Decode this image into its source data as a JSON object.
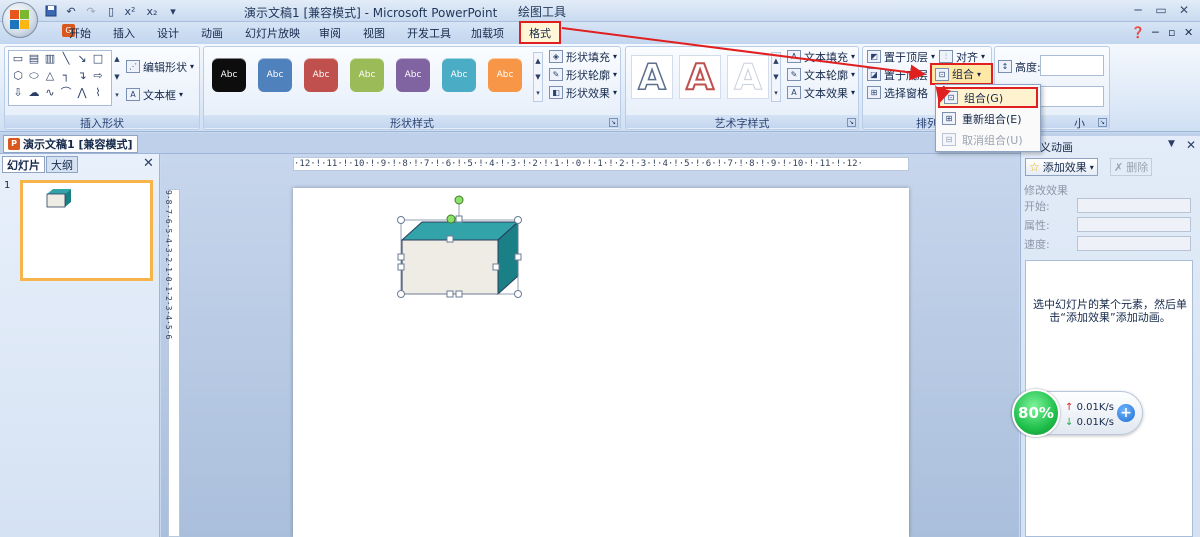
{
  "window": {
    "title": "演示文稿1 [兼容模式] - Microsoft PowerPoint",
    "context_tool_title": "绘图工具"
  },
  "tabs": {
    "home": "开始",
    "insert": "插入",
    "design": "设计",
    "animation": "动画",
    "slideshow": "幻灯片放映",
    "review": "审阅",
    "view": "视图",
    "developer": "开发工具",
    "addins": "加载项",
    "format": "格式"
  },
  "ribbon": {
    "insert_shapes": {
      "label": "插入形状",
      "edit_shape": "编辑形状",
      "text_box": "文本框"
    },
    "shape_styles": {
      "label": "形状样式",
      "sample_text": "Abc",
      "colors": [
        "#0d0d0d",
        "#4f81bd",
        "#c0504d",
        "#9bbb59",
        "#8064a2",
        "#4bacc6",
        "#f79646"
      ],
      "fill": "形状填充",
      "outline": "形状轮廓",
      "effects": "形状效果"
    },
    "wordart": {
      "label": "艺术字样式",
      "glyph": "A",
      "text_fill": "文本填充",
      "text_outline": "文本轮廓",
      "text_effects": "文本效果"
    },
    "arrange": {
      "label": "排列",
      "bring_front": "置于顶层",
      "send_back": "置于底层",
      "selection_pane": "选择窗格",
      "align": "对齐",
      "group": "组合"
    },
    "size": {
      "label": "小",
      "height": "高度:"
    }
  },
  "group_menu": {
    "group": "组合(G)",
    "regroup": "重新组合(E)",
    "ungroup": "取消组合(U)"
  },
  "document_tab": "演示文稿1 [兼容模式]",
  "left_pane": {
    "tab_slides": "幻灯片",
    "tab_outline": "大纲",
    "slide_number": "1"
  },
  "ruler": {
    "horizontal": "·12·!·11·!·10·!·9·!·8·!·7·!·6·!·5·!·4·!·3·!·2·!·1·!·0·!·1·!·2·!·3·!·4·!·5·!·6·!·7·!·8·!·9·!·10·!·11·!·12·",
    "vertical": "9·8·7·6·5·4·3·2·1·0·1·2·3·4·5·6"
  },
  "animation_pane": {
    "title": "义动画",
    "add_effect": "添加效果",
    "remove": "删除",
    "modify_effect": "修改效果",
    "start": "开始:",
    "property": "属性:",
    "speed": "速度:",
    "hint": "选中幻灯片的某个元素，然后单击“添加效果”添加动画。"
  },
  "speed_widget": {
    "percent": "80%",
    "upload": "0.01K/s",
    "download": "0.01K/s"
  },
  "colors": {
    "highlight_red": "#e02020",
    "box_front": "#eeece4",
    "box_top": "#31a3a9",
    "box_side": "#1b7f86"
  }
}
